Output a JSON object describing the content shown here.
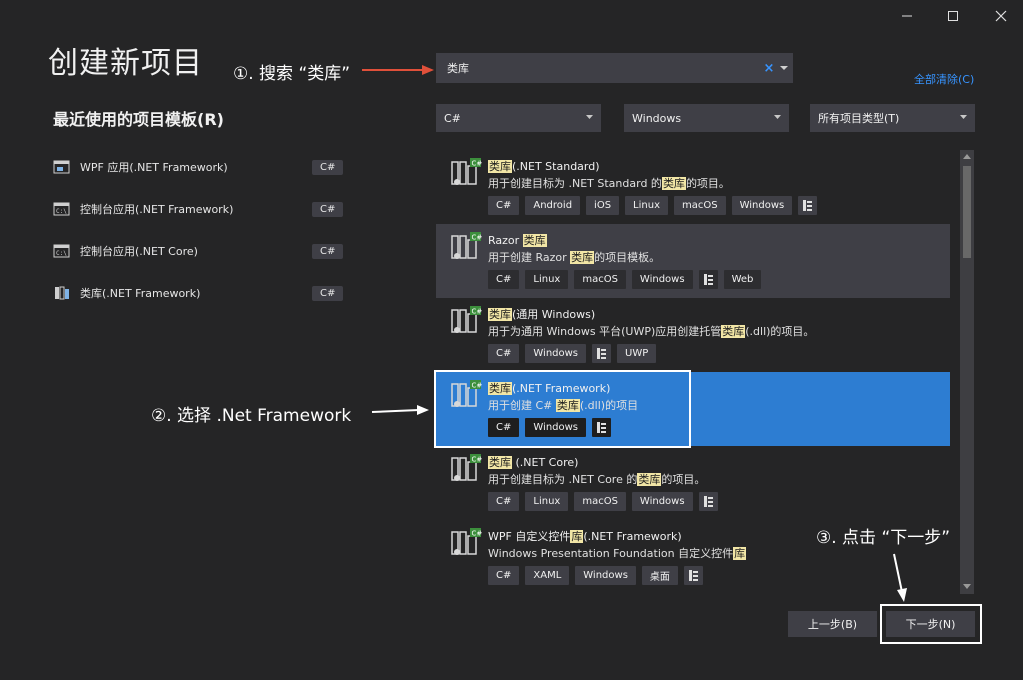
{
  "window": {
    "title": "创建新项目",
    "controls": [
      "minimize-icon",
      "maximize-icon",
      "close-icon"
    ]
  },
  "recent": {
    "heading": "最近使用的项目模板(R)",
    "items": [
      {
        "label": "WPF 应用(.NET Framework)",
        "lang": "C#",
        "icon": "wpf-app-icon"
      },
      {
        "label": "控制台应用(.NET Framework)",
        "lang": "C#",
        "icon": "console-app-icon"
      },
      {
        "label": "控制台应用(.NET Core)",
        "lang": "C#",
        "icon": "console-app-icon"
      },
      {
        "label": "类库(.NET Framework)",
        "lang": "C#",
        "icon": "class-library-icon"
      }
    ]
  },
  "search": {
    "value": "类库",
    "clear_glyph": "×"
  },
  "clear_all": "全部清除(C)",
  "filters": {
    "language": "C#",
    "platform": "Windows",
    "project_type": "所有项目类型(T)"
  },
  "templates": [
    {
      "name_pre": "",
      "name_hl": "类库",
      "name_post": "(.NET Standard)",
      "desc_pre": "用于创建目标为 .NET Standard 的",
      "desc_hl": "类库",
      "desc_post": "的项目。",
      "tags": [
        "C#",
        "Android",
        "iOS",
        "Linux",
        "macOS",
        "Windows"
      ],
      "has_lib_tag": true,
      "state": "normal"
    },
    {
      "name_pre": "Razor ",
      "name_hl": "类库",
      "name_post": "",
      "desc_pre": "用于创建 Razor ",
      "desc_hl": "类库",
      "desc_post": "的项目模板。",
      "tags": [
        "C#",
        "Linux",
        "macOS",
        "Windows"
      ],
      "has_lib_tag": true,
      "extra_tags": [
        "Web"
      ],
      "state": "hover"
    },
    {
      "name_pre": "",
      "name_hl": "类库",
      "name_post": "(通用 Windows)",
      "desc_pre": "用于为通用 Windows 平台(UWP)应用创建托管",
      "desc_hl": "类库",
      "desc_post": "(.dll)的项目。",
      "tags": [
        "C#",
        "Windows"
      ],
      "has_lib_tag": true,
      "extra_tags": [
        "UWP"
      ],
      "state": "normal"
    },
    {
      "name_pre": "",
      "name_hl": "类库",
      "name_post": "(.NET Framework)",
      "desc_pre": "用于创建 C# ",
      "desc_hl": "类库",
      "desc_post": "(.dll)的项目",
      "tags": [
        "C#",
        "Windows"
      ],
      "has_lib_tag": true,
      "state": "selected"
    },
    {
      "name_pre": "",
      "name_hl": "类库",
      "name_post": " (.NET Core)",
      "desc_pre": "用于创建目标为 .NET Core 的",
      "desc_hl": "类库",
      "desc_post": "的项目。",
      "tags": [
        "C#",
        "Linux",
        "macOS",
        "Windows"
      ],
      "has_lib_tag": true,
      "state": "normal"
    },
    {
      "name_pre": "WPF 自定义控件",
      "name_hl": "库",
      "name_post": "(.NET Framework)",
      "desc_pre": "Windows Presentation Foundation 自定义控件",
      "desc_hl": "库",
      "desc_post": "",
      "tags": [
        "C#",
        "XAML",
        "Windows",
        "桌面"
      ],
      "has_lib_tag": true,
      "state": "normal"
    }
  ],
  "annotations": {
    "step1": "①. 搜索 “类库”",
    "step2": "②. 选择 .Net Framework",
    "step3": "③. 点击 “下一步”"
  },
  "buttons": {
    "back": "上一步(B)",
    "next": "下一步(N)"
  },
  "colors": {
    "background": "#252526",
    "control": "#3f3f46",
    "selected": "#2d7dd2",
    "accent_link": "#3794ff",
    "highlight": "#f2e6a6",
    "annotation_arrow_red": "#e0503a"
  }
}
